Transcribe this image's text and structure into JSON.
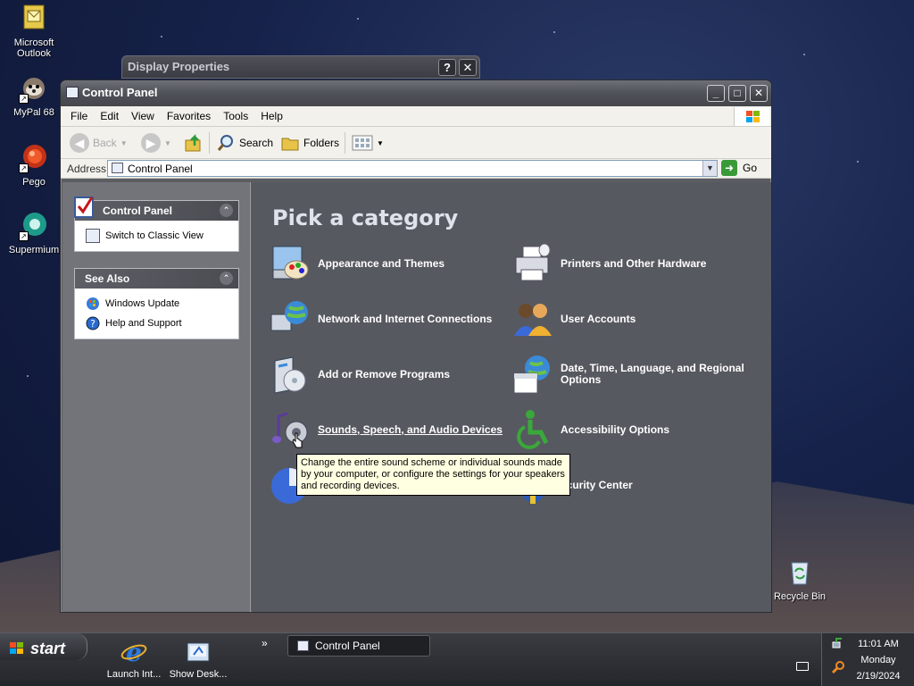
{
  "desktop": {
    "icons": [
      {
        "label": "Microsoft Outlook",
        "icon": "outlook-icon"
      },
      {
        "label": "MyPal 68",
        "icon": "mypal-icon"
      },
      {
        "label": "Pego",
        "icon": "pego-icon"
      },
      {
        "label": "Supermium",
        "icon": "supermium-icon"
      },
      {
        "label": "Recycle Bin",
        "icon": "recycle-bin-icon"
      }
    ]
  },
  "background_window": {
    "title": "Display Properties",
    "help": "?",
    "close": "✕"
  },
  "window": {
    "title": "Control Panel",
    "controls": {
      "minimize": "_",
      "maximize": "□",
      "close": "✕"
    },
    "menu": [
      "File",
      "Edit",
      "View",
      "Favorites",
      "Tools",
      "Help"
    ],
    "toolbar": {
      "back": "Back",
      "search": "Search",
      "folders": "Folders"
    },
    "address": {
      "label": "Address",
      "value": "Control Panel",
      "go": "Go"
    }
  },
  "left_pane": {
    "control_panel_box": {
      "title": "Control Panel",
      "items": [
        "Switch to Classic View"
      ]
    },
    "see_also_box": {
      "title": "See Also",
      "items": [
        "Windows Update",
        "Help and Support"
      ]
    }
  },
  "main": {
    "heading": "Pick a category",
    "categories": [
      {
        "label": "Appearance and Themes",
        "icon": "appearance-themes-icon"
      },
      {
        "label": "Printers and Other Hardware",
        "icon": "printers-hardware-icon"
      },
      {
        "label": "Network and Internet Connections",
        "icon": "network-icon"
      },
      {
        "label": "User Accounts",
        "icon": "user-accounts-icon"
      },
      {
        "label": "Add or Remove Programs",
        "icon": "add-remove-programs-icon"
      },
      {
        "label": "Date, Time, Language, and Regional Options",
        "icon": "date-time-globe-icon"
      },
      {
        "label": "Sounds, Speech, and Audio Devices",
        "icon": "sounds-audio-icon"
      },
      {
        "label": "Accessibility Options",
        "icon": "accessibility-icon"
      },
      {
        "label": "ecurity Center",
        "icon": "security-center-icon"
      }
    ],
    "tooltip": "Change the entire sound scheme or individual sounds made by your computer, or configure the settings for your speakers and recording devices."
  },
  "taskbar": {
    "start": "start",
    "quick_launch": [
      {
        "label": "Launch Int...",
        "icon": "internet-explorer-icon"
      },
      {
        "label": "Show Desk...",
        "icon": "show-desktop-icon"
      }
    ],
    "overflow": "»",
    "tasks": [
      {
        "label": "Control Panel"
      }
    ],
    "clock": {
      "time": "11:01 AM",
      "day": "Monday",
      "date": "2/19/2024"
    }
  },
  "colors": {
    "titlebar": "#505259",
    "pane": "#575960",
    "tooltip": "#ffffe1",
    "accent_green": "#3a9a3a"
  }
}
